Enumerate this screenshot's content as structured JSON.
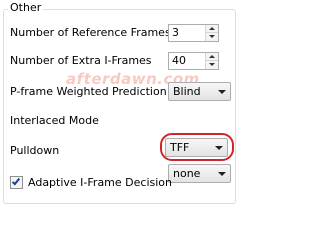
{
  "group": {
    "title": "Other"
  },
  "watermark": {
    "text": "afterdawn.com"
  },
  "rows": {
    "ref_frames": {
      "label": "Number of Reference Frames",
      "value": "3"
    },
    "extra_iframes": {
      "label": "Number of Extra I-Frames",
      "value": "40"
    },
    "pframe_weighted": {
      "label": "P-frame Weighted Prediction",
      "value": "Blind"
    },
    "interlaced": {
      "label": "Interlaced Mode",
      "value": "TFF"
    },
    "pulldown": {
      "label": "Pulldown",
      "value": "none"
    }
  },
  "adaptive": {
    "label": "Adaptive I-Frame Decision",
    "checked": true
  },
  "colors": {
    "highlight": "#d0262a",
    "watermark": "#f08a76"
  },
  "icons": [
    "spin-up-icon",
    "spin-down-icon",
    "dropdown-arrow-icon",
    "checkmark-icon"
  ]
}
